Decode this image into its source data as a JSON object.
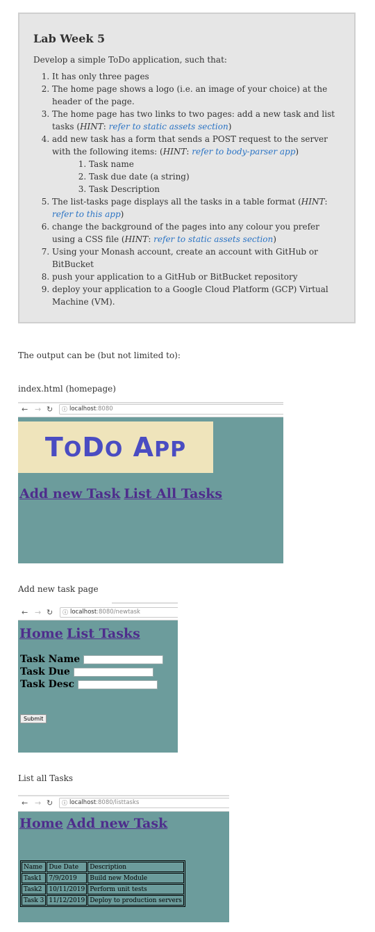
{
  "lab": {
    "title": "Lab  Week 5",
    "intro": "Develop a simple ToDo application, such that:",
    "items": {
      "i1": "It has only three pages",
      "i2": "The home page shows a logo (i.e. an image of your choice) at the header of the page.",
      "i3_pre": "The home page has two links to two pages: add a new task and list tasks (",
      "i3_link": "refer to static assets section",
      "i4_pre": "add new task has a form that sends a POST request to the server with the following items: (",
      "i4_link": "refer to body-parser app",
      "i5_pre": "The list-tasks page displays all the tasks in a table format (",
      "i5_link": "refer to this app",
      "i6_pre": "change the background of the pages into any colour you prefer using a CSS file  (",
      "i6_link": "refer to static assets section",
      "i7": "Using your Monash account, create an account with GitHub or BitBucket",
      "i8": "push your application to a GitHub or BitBucket repository",
      "i9": "deploy your application to a Google Cloud Platform (GCP) Virtual Machine (VM)."
    },
    "hint": "HINT",
    "sub_items": [
      "Task name",
      "Task due date (a string)",
      "Task Description"
    ]
  },
  "output_intro": "The output can be (but not limited to):",
  "shots": {
    "home": {
      "caption": "index.html (homepage)",
      "url_host": "localhost",
      "url_path": ":8080",
      "logo_T": "T",
      "logo_o": "O",
      "logo_D": "D",
      "logo_o2": "O",
      "logo_A": "A",
      "logo_pp": "PP",
      "link1": "Add new Task",
      "link2": "List All Tasks"
    },
    "newtask": {
      "caption": "Add new task page",
      "url_host": "localhost",
      "url_path": ":8080/newtask",
      "link1": "Home",
      "link2": "List Tasks",
      "label_name": "Task Name",
      "label_due": "Task Due",
      "label_desc": "Task Desc",
      "submit": "Submit"
    },
    "listtasks": {
      "caption": "List all Tasks",
      "url_host": "localhost",
      "url_path": ":8080/listtasks",
      "link1": "Home",
      "link2": "Add new Task",
      "table": [
        [
          "Name",
          "Due Date",
          "Description"
        ],
        [
          "Task1",
          "7/9/2019",
          "Build new Module"
        ],
        [
          "Task2",
          "10/11/2019",
          "Perform unit tests"
        ],
        [
          "Task 3",
          "11/12/2019",
          "Deploy to production servers"
        ]
      ]
    }
  },
  "icons": {
    "back": "left-arrow",
    "forward": "right-arrow",
    "reload": "reload",
    "info": "info"
  }
}
